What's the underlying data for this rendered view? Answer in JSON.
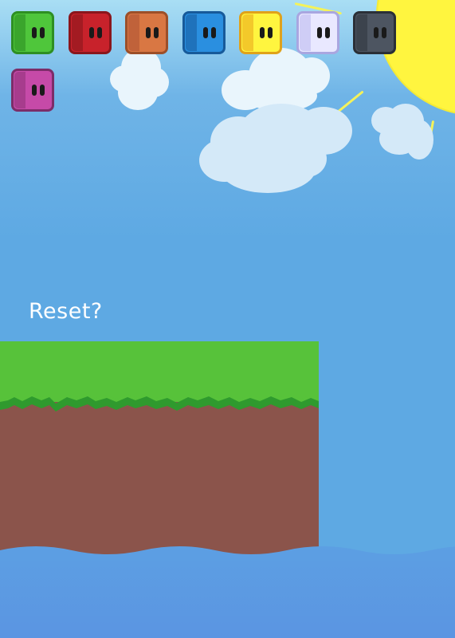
{
  "game": {
    "reset_label": "Reset?"
  },
  "tiles": [
    {
      "name": "green",
      "color": "#4fc63b",
      "border": "#2e8f23",
      "shade": "#3aa52c"
    },
    {
      "name": "red",
      "color": "#c8222b",
      "border": "#8a161c",
      "shade": "#a31b22"
    },
    {
      "name": "orange",
      "color": "#d97743",
      "border": "#9c4f29",
      "shade": "#c0623a"
    },
    {
      "name": "blue",
      "color": "#2a8fe0",
      "border": "#175a9a",
      "shade": "#1f72bb"
    },
    {
      "name": "yellow",
      "color": "#fff53f",
      "border": "#e0a21a",
      "shade": "#f3c92a"
    },
    {
      "name": "lavender",
      "color": "#e9e8ff",
      "border": "#a9a6e0",
      "shade": "#cfcdf6"
    },
    {
      "name": "dark-gray",
      "color": "#4d5561",
      "border": "#2a2f37",
      "shade": "#3c434d"
    },
    {
      "name": "magenta",
      "color": "#c64aa8",
      "border": "#7c2d69",
      "shade": "#a73c8d"
    }
  ],
  "colors": {
    "sky_top": "#a9def4",
    "sky": "#5ea9e3",
    "sun": "#fff53f",
    "grass": "#57c23a",
    "grass_edge": "#2f9a2e",
    "dirt": "#8b544b",
    "water": "#5d9be3"
  }
}
